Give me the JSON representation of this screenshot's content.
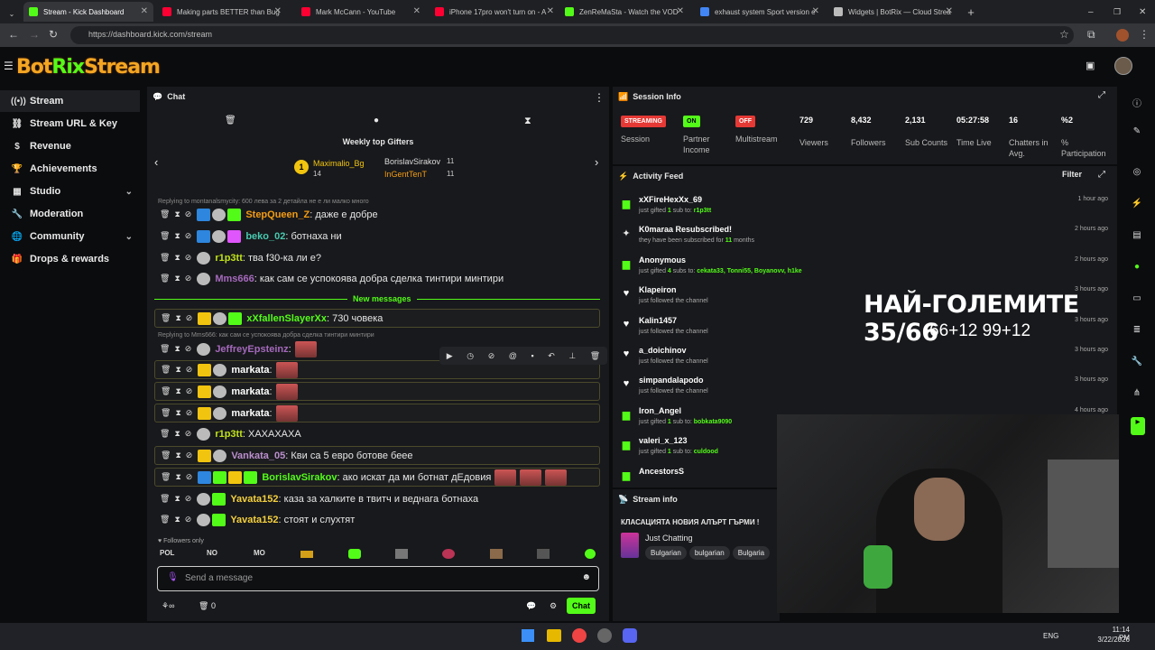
{
  "browser": {
    "tabs": [
      {
        "title": "Stream - Kick Dashboard",
        "color": "#53fc18"
      },
      {
        "title": "Making parts BETTER than Bug",
        "color": "#ff0033"
      },
      {
        "title": "Mark McCann - YouTube",
        "color": "#ff0033"
      },
      {
        "title": "iPhone 17pro won't turn on - A",
        "color": "#ff0033"
      },
      {
        "title": "ZenReMaSta - Watch the VOD",
        "color": "#53fc18"
      },
      {
        "title": "exhaust system Sport version e",
        "color": "#4285f4"
      },
      {
        "title": "Widgets | BotRix — Cloud Strea",
        "color": "#bbbbbb"
      }
    ],
    "url": "https://dashboard.kick.com/stream"
  },
  "app": {
    "logo_text": "BotRixStream"
  },
  "sidebar": {
    "items": [
      {
        "label": "Stream",
        "icon": "stream-icon"
      },
      {
        "label": "Stream URL & Key",
        "icon": "link-icon"
      },
      {
        "label": "Revenue",
        "icon": "dollar-icon"
      },
      {
        "label": "Achievements",
        "icon": "trophy-icon"
      },
      {
        "label": "Studio",
        "icon": "studio-icon"
      },
      {
        "label": "Moderation",
        "icon": "wrench-icon"
      },
      {
        "label": "Community",
        "icon": "globe-icon"
      },
      {
        "label": "Drops & rewards",
        "icon": "gift-icon"
      }
    ]
  },
  "chat": {
    "title": "Chat",
    "weekly_title": "Weekly top Gifters",
    "gifters": [
      {
        "rank": "1",
        "name": "Maximalio_Bg",
        "count": "14"
      },
      {
        "name": "BorislavSirakov",
        "count": "11"
      },
      {
        "name": "InGentTenT",
        "count": "11"
      }
    ],
    "reply1": "Replying to montanalsmycity: 600 лева за 2 детайла не е ли малко много",
    "reply2": "Replying to Mms666: как сам се успокоява добра сделка тинтири минтири",
    "new_messages": "New messages",
    "messages": [
      {
        "user": "StepQueen_Z",
        "color": "#f39c12",
        "text": ": даже е добре"
      },
      {
        "user": "beko_02",
        "color": "#48c9b0",
        "text": ": ботнаха ни"
      },
      {
        "user": "r1p3tt",
        "color": "#c0e218",
        "text": ": тва f30-ка ли е?"
      },
      {
        "user": "Mms666",
        "color": "#a569bd",
        "text": ": как сам се успокоява добра сделка тинтири минтири"
      },
      {
        "user": "xXfallenSlayerXx",
        "color": "#53fc18",
        "text": ": 730 човека"
      },
      {
        "user": "JeffreyEpsteinz",
        "color": "#a569bd",
        "text": ":"
      },
      {
        "user": "markata",
        "color": "#ffffff",
        "text": ":"
      },
      {
        "user": "markata",
        "color": "#ffffff",
        "text": ":"
      },
      {
        "user": "markata",
        "color": "#ffffff",
        "text": ":"
      },
      {
        "user": "r1p3tt",
        "color": "#c0e218",
        "text": ": ХАХАХАХА"
      },
      {
        "user": "Vankata_05",
        "color": "#bb8fce",
        "text": ": Кви са 5 евро ботове беее"
      },
      {
        "user": "BorislavSirakov",
        "color": "#53fc18",
        "text": ": ако искат да ми ботнат дЕдовия"
      },
      {
        "user": "Yavata152",
        "color": "#f4d03f",
        "text": ": каза за халките в твитч и веднага ботнаха"
      },
      {
        "user": "Yavata152",
        "color": "#f4d03f",
        "text": ": стоят и слухтят"
      }
    ],
    "followers_only": "Followers only",
    "shortcuts": [
      "POL",
      "NO",
      "MO"
    ],
    "input_placeholder": "Send a message",
    "send_label": "Chat",
    "bottom_count": "0"
  },
  "session": {
    "title": "Session Info",
    "pills": [
      {
        "label": "STREAMING",
        "sub": "Session",
        "color": "#e53935"
      },
      {
        "label": "ON",
        "sub": "Partner Income",
        "color": "#53fc18"
      },
      {
        "label": "OFF",
        "sub": "Multistream",
        "color": "#e53935"
      }
    ],
    "stats": [
      {
        "value": "729",
        "label": "Viewers"
      },
      {
        "value": "8,432",
        "label": "Followers"
      },
      {
        "value": "2,131",
        "label": "Sub Counts"
      },
      {
        "value": "05:27:58",
        "label": "Time Live"
      },
      {
        "value": "16",
        "label": "Chatters in Avg."
      },
      {
        "value": "%2",
        "label": "% Participation"
      }
    ]
  },
  "activity": {
    "title": "Activity Feed",
    "filter_label": "Filter",
    "items": [
      {
        "name": "xXFireHexXx_69",
        "desc_pre": "just gifted ",
        "desc_hl": "1",
        "desc_mid": " sub to: ",
        "desc_hl2": "r1p3tt",
        "time": "1 hour ago",
        "icon": "gift-icon"
      },
      {
        "name": "K0maraa Resubscribed!",
        "desc_pre": "they have been subscribed for ",
        "desc_hl": "11",
        "desc_mid": " months",
        "desc_hl2": "",
        "time": "2 hours ago",
        "icon": "star-icon"
      },
      {
        "name": "Anonymous",
        "desc_pre": "just gifted ",
        "desc_hl": "4",
        "desc_mid": " subs to: ",
        "desc_hl2": "cekata33, Tonni55, Boyanovv, h1ke",
        "time": "2 hours ago",
        "icon": "gift-icon"
      },
      {
        "name": "Klapeiron",
        "desc_pre": "just followed the channel",
        "desc_hl": "",
        "desc_mid": "",
        "desc_hl2": "",
        "time": "3 hours ago",
        "icon": "heart-icon"
      },
      {
        "name": "Kalin1457",
        "desc_pre": "just followed the channel",
        "desc_hl": "",
        "desc_mid": "",
        "desc_hl2": "",
        "time": "3 hours ago",
        "icon": "heart-icon"
      },
      {
        "name": "a_doichinov",
        "desc_pre": "just followed the channel",
        "desc_hl": "",
        "desc_mid": "",
        "desc_hl2": "",
        "time": "3 hours ago",
        "icon": "heart-icon"
      },
      {
        "name": "simpandalapodo",
        "desc_pre": "just followed the channel",
        "desc_hl": "",
        "desc_mid": "",
        "desc_hl2": "",
        "time": "3 hours ago",
        "icon": "heart-icon"
      },
      {
        "name": "Iron_Angel",
        "desc_pre": "just gifted ",
        "desc_hl": "1",
        "desc_mid": " sub to: ",
        "desc_hl2": "bobkata9090",
        "time": "4 hours ago",
        "icon": "gift-icon"
      },
      {
        "name": "valeri_x_123",
        "desc_pre": "just gifted ",
        "desc_hl": "1",
        "desc_mid": " sub to: ",
        "desc_hl2": "culdood",
        "time": "",
        "icon": "gift-icon"
      },
      {
        "name": "AncestorsS",
        "desc_pre": "",
        "desc_hl": "",
        "desc_mid": "",
        "desc_hl2": "",
        "time": "",
        "icon": "gift-icon"
      }
    ]
  },
  "stream_info": {
    "title": "Stream info",
    "stream_title": "КЛАСАЦИЯТА НОВИЯ АЛЪРТ ГЪРМИ !",
    "category": "Just Chatting",
    "tags": [
      "Bulgarian",
      "bulgarian",
      "Bulgaria"
    ]
  },
  "overlay": {
    "title": "НАЙ-ГОЛЕМИТЕ 35/66",
    "sub": "66+12 99+12"
  },
  "taskbar": {
    "lang": "ENG",
    "time": "11:14 PM",
    "date": "3/22/2026"
  }
}
